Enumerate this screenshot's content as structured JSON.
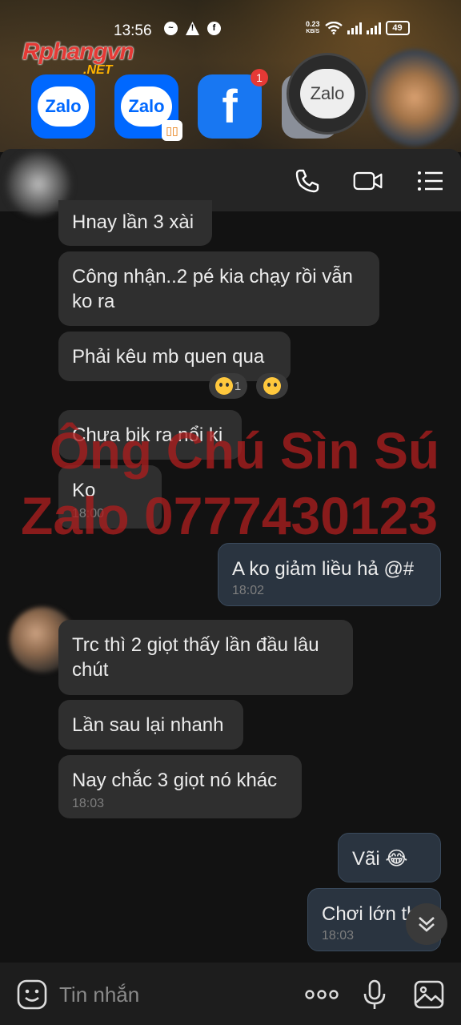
{
  "status_bar": {
    "time": "13:56",
    "net_speed_value": "0.23",
    "net_speed_unit": "KB/S",
    "battery": "49"
  },
  "brand": {
    "name": "Rphangvn",
    "suffix": ".NET"
  },
  "app_row": {
    "zalo_label": "Zalo",
    "facebook_letter": "f",
    "facebook_badge": "1",
    "floating_zalo_label": "Zalo"
  },
  "header": {
    "icons": [
      "phone-icon",
      "video-call-icon",
      "menu-list-icon"
    ]
  },
  "messages": [
    {
      "id": "m1",
      "direction": "in",
      "text": "Hnay lần 3 xài",
      "time": ""
    },
    {
      "id": "m2",
      "direction": "in",
      "text": "Công nhận..2 pé kia chạy rồi vẫn\nko ra",
      "time": ""
    },
    {
      "id": "m3",
      "direction": "in",
      "text": "Phải kêu mb quen qua",
      "time": "",
      "reaction_count": "1"
    },
    {
      "id": "m4",
      "direction": "in",
      "text": "Chưa bik ra nổi ki",
      "time": ""
    },
    {
      "id": "m5",
      "direction": "in",
      "text": "Ko",
      "time": "18:00"
    },
    {
      "id": "m6",
      "direction": "out",
      "text": "A ko giảm  liều hả @#",
      "time": "18:02"
    },
    {
      "id": "m7",
      "direction": "in",
      "text": "Trc thì 2 giọt thấy lần đầu lâu\nchút",
      "time": ""
    },
    {
      "id": "m8",
      "direction": "in",
      "text": "Lần sau lại nhanh",
      "time": ""
    },
    {
      "id": "m9",
      "direction": "in",
      "text": "Nay chắc 3 giọt nó khác",
      "time": "18:03"
    },
    {
      "id": "m10",
      "direction": "out",
      "text": "Vãi 😂",
      "time": ""
    },
    {
      "id": "m11",
      "direction": "out",
      "text": "Chơi lớn thế",
      "time": "18:03"
    }
  ],
  "watermark": {
    "line1": "Ông Chú Sìn Sú",
    "line2": "Zalo 0777430123"
  },
  "composer": {
    "placeholder": "Tin nhắn",
    "icons": [
      "emoji-sticker-icon",
      "more-dots-icon",
      "microphone-icon",
      "image-gallery-icon"
    ]
  },
  "colors": {
    "background": "#121212",
    "incoming_bubble": "#2f2f2f",
    "outgoing_bubble": "#2a3440",
    "watermark": "#aa1e1e",
    "zalo_blue": "#0068ff"
  }
}
